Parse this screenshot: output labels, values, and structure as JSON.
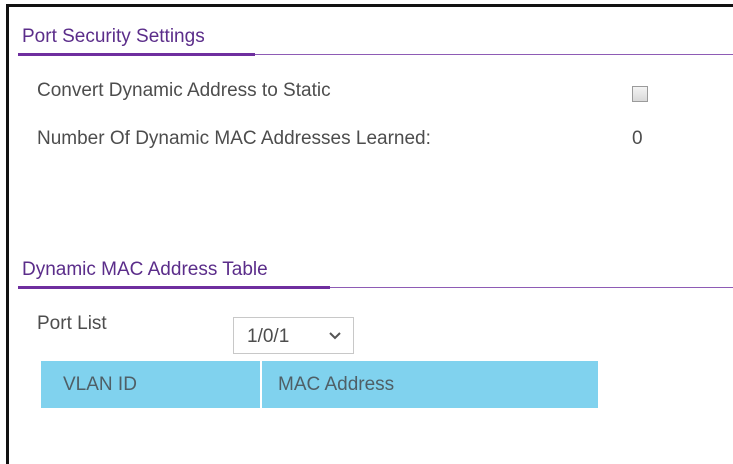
{
  "port_security": {
    "title": "Port Security Settings",
    "convert_label": "Convert Dynamic Address to Static",
    "convert_checked": false,
    "learned_label": "Number Of Dynamic MAC Addresses Learned:",
    "learned_value": "0"
  },
  "dynamic_mac_table": {
    "title": "Dynamic MAC Address Table",
    "port_list_label": "Port List",
    "port_list_selected": "1/0/1",
    "columns": [
      "VLAN ID",
      "MAC Address"
    ]
  },
  "colors": {
    "section_title": "#5b2d8a",
    "accent_underline": "#6f2f9f",
    "table_header_bg": "#80d2ee"
  },
  "icons": {
    "dropdown": "chevron-down-icon"
  }
}
